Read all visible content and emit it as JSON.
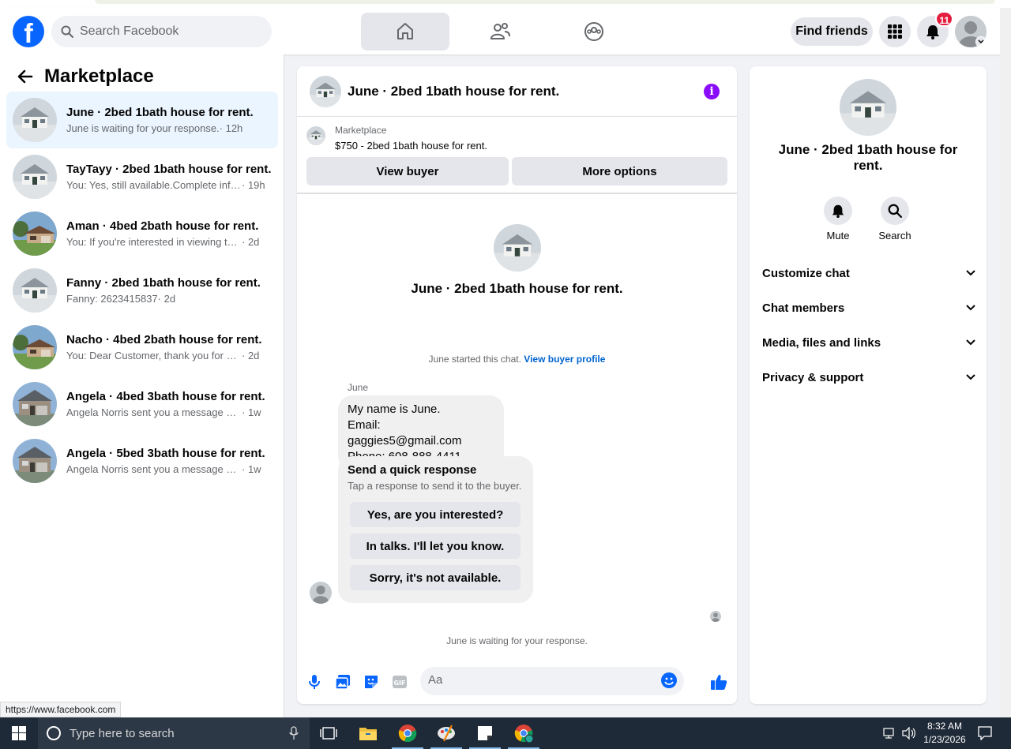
{
  "topnav": {
    "logo": "f",
    "search_placeholder": "Search Facebook",
    "find_friends": "Find friends",
    "notifications_count": "11"
  },
  "left": {
    "title": "Marketplace",
    "conversations": [
      {
        "title": "June · 2bed 1bath house for rent.",
        "message": "June is waiting for your response.",
        "time": " · 12h",
        "active": true
      },
      {
        "title": "TayTayy · 2bed 1bath house for rent.",
        "message": "You: Yes, still available.Complete info...",
        "time": " · 19h"
      },
      {
        "title": "Aman · 4bed 2bath house for rent.",
        "message": "You: If you're interested in viewing the...",
        "time": " · 2d"
      },
      {
        "title": "Fanny · 2bed 1bath house for rent.",
        "message": "Fanny: 2623415837",
        "time": " · 2d"
      },
      {
        "title": "Nacho · 4bed 2bath house for rent.",
        "message": "You: Dear Customer, thank you for as...",
        "time": " · 2d"
      },
      {
        "title": "Angela · 4bed 3bath house for rent.",
        "message": "Angela Norris sent you a message ab...",
        "time": " · 1w"
      },
      {
        "title": "Angela · 5bed 3bath house for rent.",
        "message": "Angela Norris sent you a message ab...",
        "time": " · 1w"
      }
    ],
    "status_url": "https://www.facebook.com"
  },
  "chat": {
    "title": "June · 2bed 1bath house for rent.",
    "listing_label": "Marketplace",
    "listing_price": "$750 - 2bed 1bath house for rent.",
    "view_buyer": "View buyer",
    "more_options": "More options",
    "profile_name": "June · 2bed 1bath house for rent.",
    "started_text": "June started this chat.",
    "view_buyer_profile": "View buyer profile",
    "sender": "June",
    "message_lines": [
      "My name is June.",
      "Email: gaggies5@gmail.com",
      "Phone: 608-888-4411"
    ],
    "quick_title": "Send a quick response",
    "quick_sub": "Tap a response to send it to the buyer.",
    "quick_replies": [
      "Yes, are you interested?",
      "In talks. I'll let you know.",
      "Sorry, it's not available."
    ],
    "waiting": "June is waiting for your response.",
    "composer_placeholder": "Aa"
  },
  "right": {
    "name": "June · 2bed 1bath house for rent.",
    "mute": "Mute",
    "search": "Search",
    "sections": [
      "Customize chat",
      "Chat members",
      "Media, files and links",
      "Privacy & support"
    ]
  },
  "taskbar": {
    "search_placeholder": "Type here to search",
    "time": "8:32 AM",
    "date": "1/23/2026"
  },
  "colors": {
    "brand": "#0866ff",
    "info": "#8a0cfb",
    "badge": "#e41e3f",
    "active_conv": "#ebf5ff",
    "link": "#0064d1"
  }
}
